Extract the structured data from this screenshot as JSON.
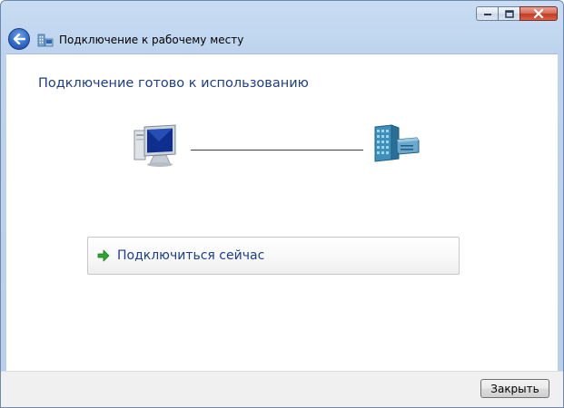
{
  "window": {
    "title": "Подключение к рабочему месту"
  },
  "content": {
    "heading": "Подключение готово к использованию",
    "connect_option": {
      "label": "Подключиться сейчас",
      "icon": "green-arrow-icon"
    }
  },
  "footer": {
    "close_label": "Закрыть"
  },
  "icons": {
    "back": "back-arrow-icon",
    "wizard": "workplace-network-icon",
    "computer": "computer-icon",
    "server": "server-icon"
  },
  "colors": {
    "heading_text": "#1d3d8c",
    "titlebar": "#bed4ee",
    "close_caption": "#c43b22",
    "connect_arrow": "#2ea52e"
  }
}
